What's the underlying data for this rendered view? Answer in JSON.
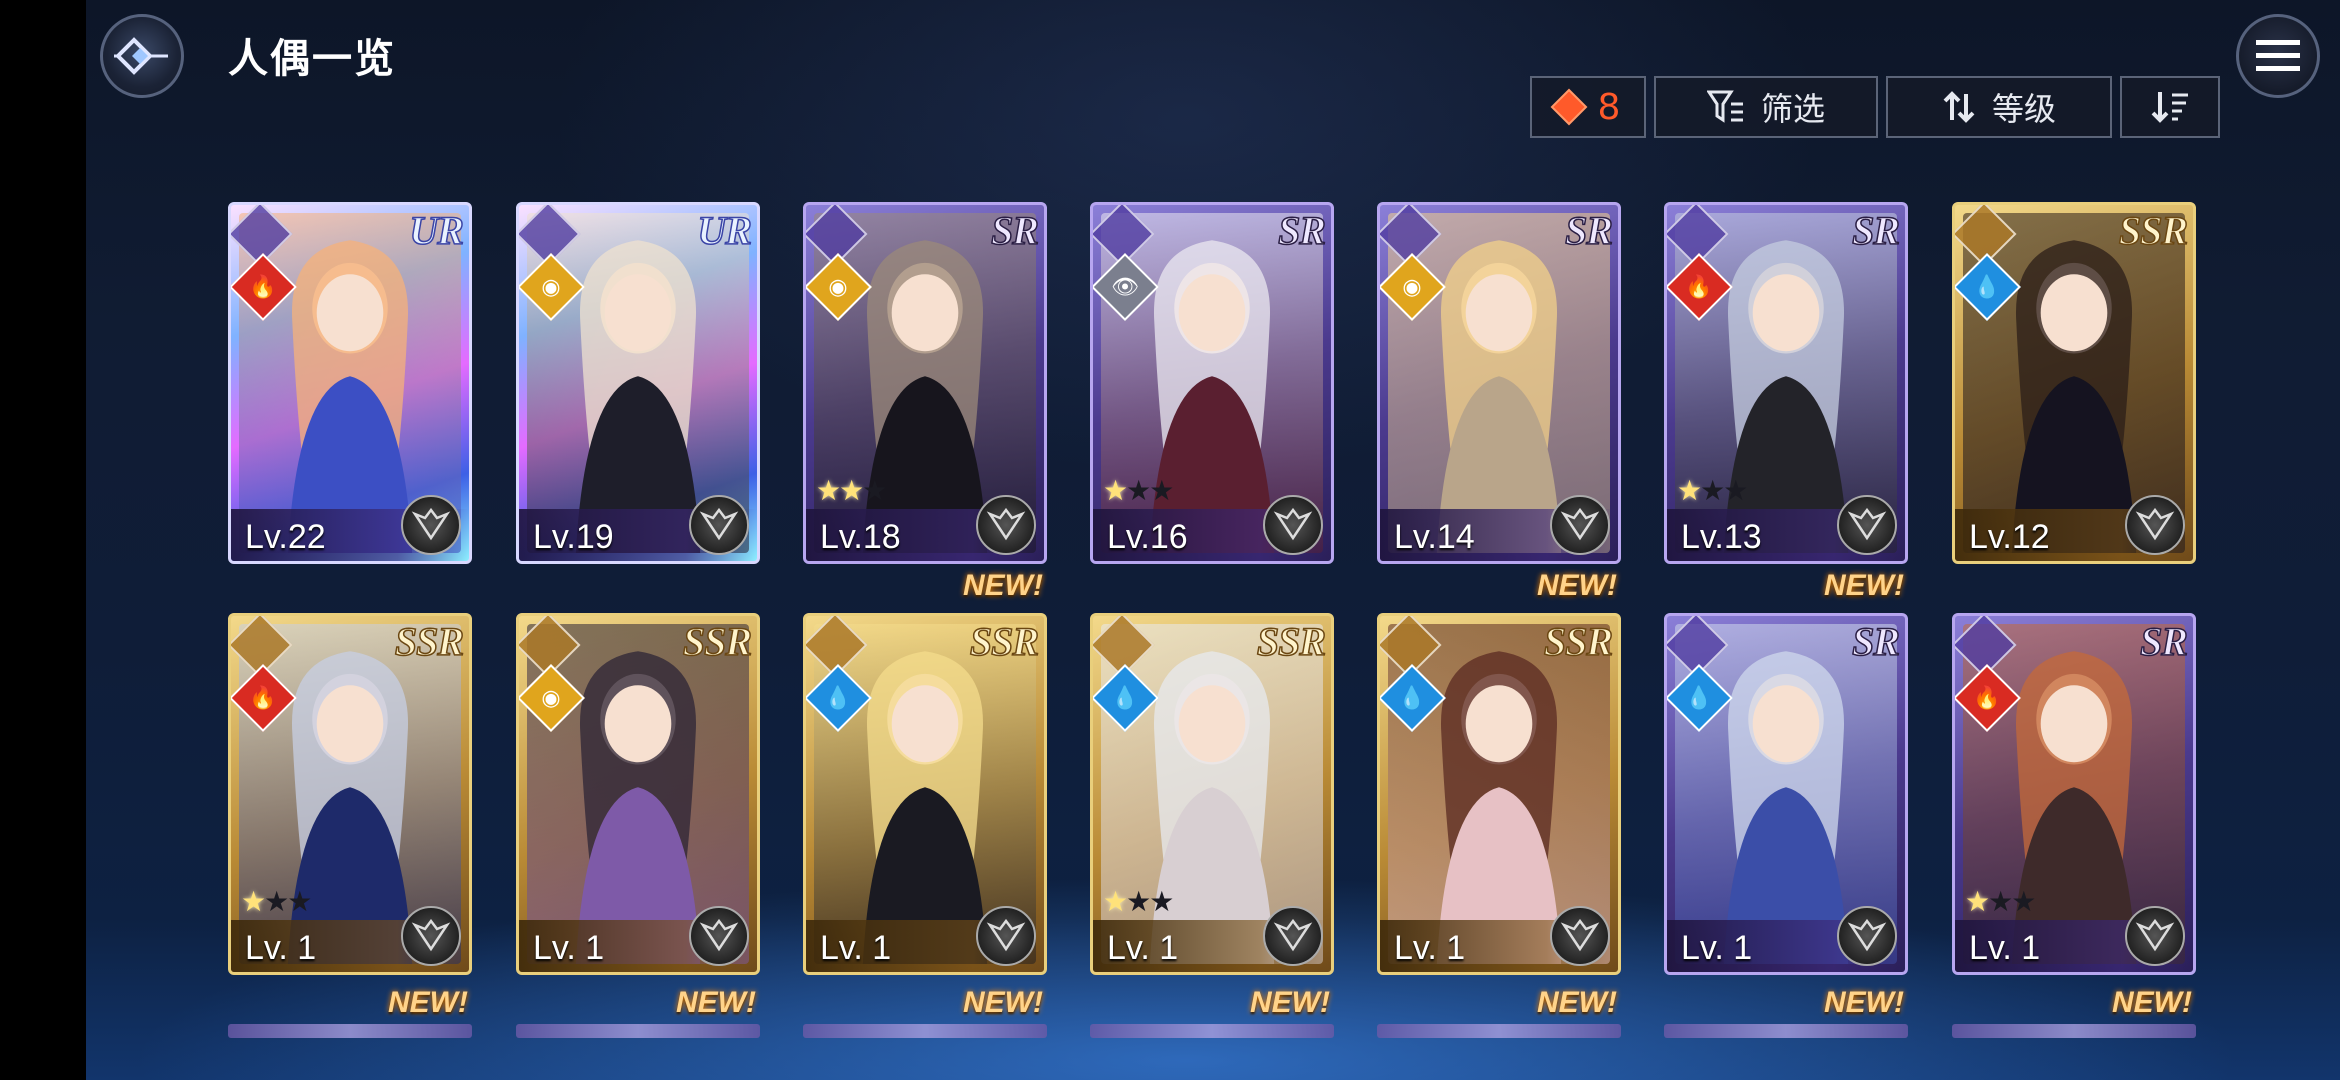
{
  "header": {
    "title": "人偶一览",
    "count": "8",
    "filter_label": "筛选",
    "sort_label": "等级"
  },
  "colors": {
    "count_accent": "#ff5a2a",
    "ur_frame": "#d8d8ff",
    "sr_frame": "#b7a6f0",
    "ssr_frame": "#e9cf7c"
  },
  "row1": [
    {
      "rarity": "UR",
      "element": "fire",
      "level": "Lv.22",
      "stars": 0,
      "new": ""
    },
    {
      "rarity": "UR",
      "element": "light",
      "level": "Lv.19",
      "stars": 0,
      "new": ""
    },
    {
      "rarity": "SR",
      "element": "light",
      "level": "Lv.18",
      "stars": 2,
      "new": ""
    },
    {
      "rarity": "SR",
      "element": "dark",
      "level": "Lv.16",
      "stars": 1,
      "new": ""
    },
    {
      "rarity": "SR",
      "element": "light",
      "level": "Lv.14",
      "stars": 0,
      "new": ""
    },
    {
      "rarity": "SR",
      "element": "fire",
      "level": "Lv.13",
      "stars": 1,
      "new": ""
    },
    {
      "rarity": "SSR",
      "element": "water",
      "level": "Lv.12",
      "stars": 0,
      "new": ""
    }
  ],
  "row2": [
    {
      "rarity": "SSR",
      "element": "fire",
      "level": "Lv. 1",
      "stars": 1,
      "new": ""
    },
    {
      "rarity": "SSR",
      "element": "light",
      "level": "Lv. 1",
      "stars": 0,
      "new": ""
    },
    {
      "rarity": "SSR",
      "element": "water",
      "level": "Lv. 1",
      "stars": 0,
      "new": "NEW!"
    },
    {
      "rarity": "SSR",
      "element": "water",
      "level": "Lv. 1",
      "stars": 1,
      "new": ""
    },
    {
      "rarity": "SSR",
      "element": "water",
      "level": "Lv. 1",
      "stars": 0,
      "new": "NEW!"
    },
    {
      "rarity": "SR",
      "element": "water",
      "level": "Lv. 1",
      "stars": 0,
      "new": "NEW!"
    },
    {
      "rarity": "SR",
      "element": "fire",
      "level": "Lv. 1",
      "stars": 1,
      "new": ""
    }
  ],
  "row3_new": [
    "NEW!",
    "NEW!",
    "NEW!",
    "NEW!",
    "NEW!",
    "NEW!",
    "NEW!"
  ]
}
